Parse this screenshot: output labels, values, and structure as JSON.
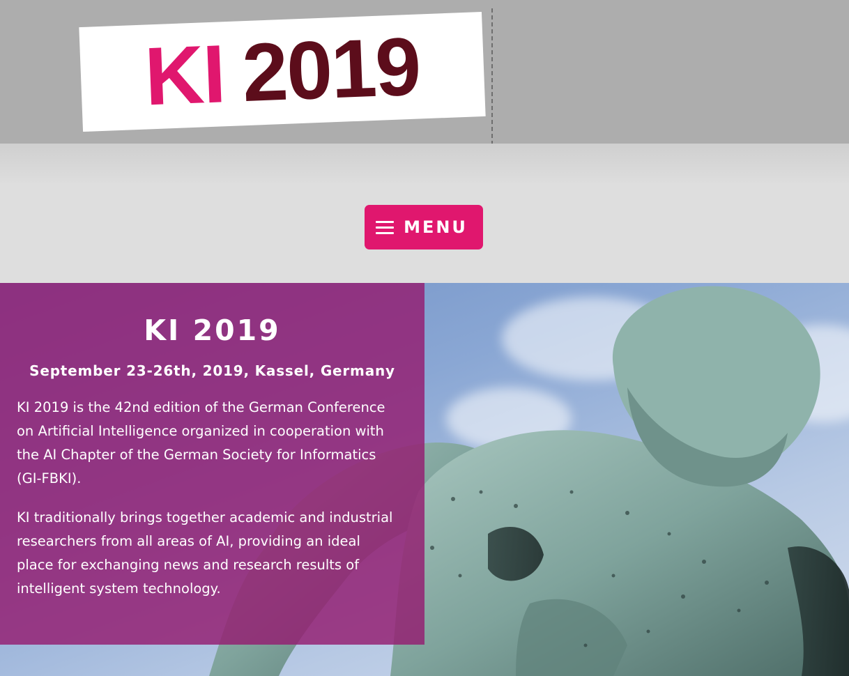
{
  "header": {
    "logo_ki": "KI",
    "logo_year": "2019",
    "brand_color": "#e0176e",
    "year_color": "#5c0d1b"
  },
  "nav": {
    "menu_label": "MENU",
    "menu_icon": "hamburger-icon"
  },
  "hero": {
    "title": "KI 2019",
    "subtitle": "September 23-26th, 2019, Kassel, Germany",
    "paragraphs": [
      "KI 2019 is the 42nd edition of the German Conference on Artificial Intelligence organized in cooperation with the AI Chapter of the German Society for Informatics (GI-FBKI).",
      "KI traditionally brings together academic and industrial researchers from all areas of AI, providing an ideal place for exchanging news and research results of intelligent system technology."
    ],
    "panel_color": "#941c70",
    "image": "hercules-statue-photo"
  }
}
